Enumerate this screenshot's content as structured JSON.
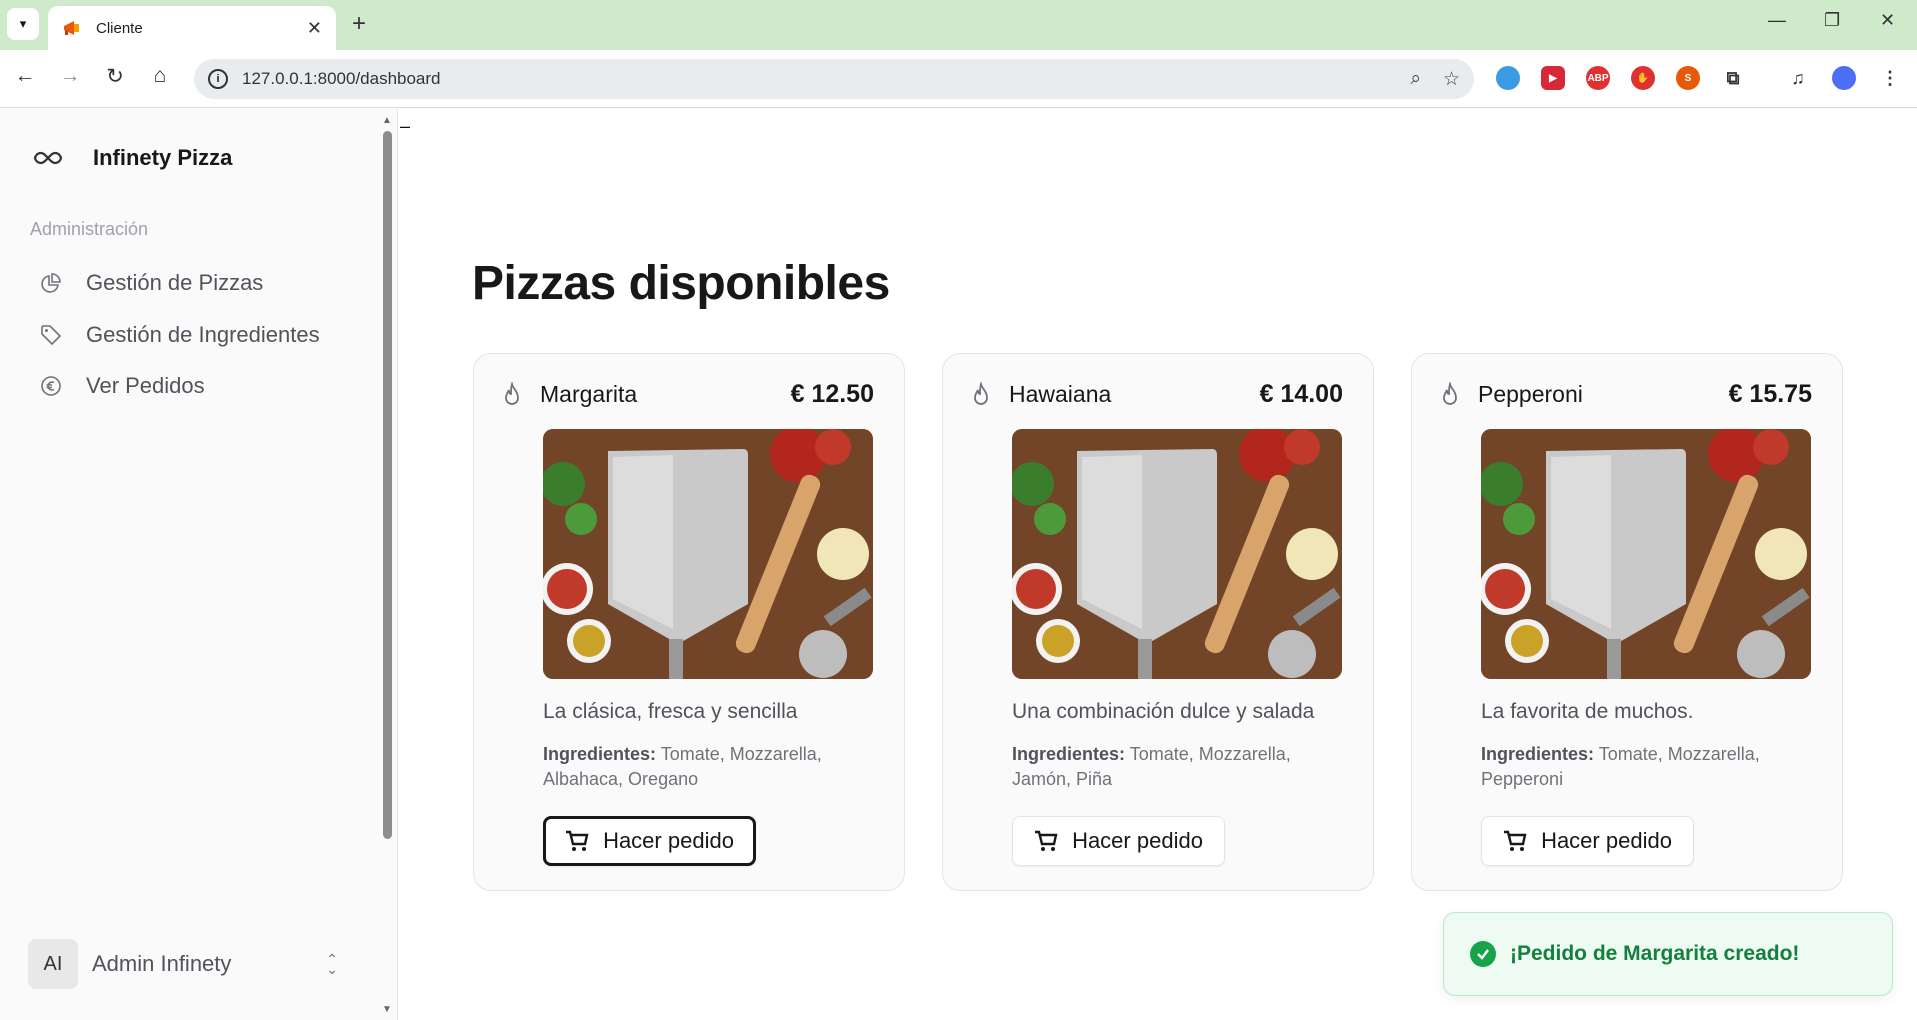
{
  "browser": {
    "tab_title": "Cliente",
    "url": "127.0.0.1:8000/dashboard",
    "accent": "#cfeacb"
  },
  "sidebar": {
    "brand": "Infinety Pizza",
    "section_label": "Administración",
    "items": [
      {
        "label": "Gestión de Pizzas",
        "icon": "pie-chart-icon"
      },
      {
        "label": "Gestión de Ingredientes",
        "icon": "tag-icon"
      },
      {
        "label": "Ver Pedidos",
        "icon": "euro-icon"
      }
    ],
    "user": {
      "initials": "AI",
      "name": "Admin Infinety"
    }
  },
  "main": {
    "cursor_mark": "–",
    "title": "Pizzas disponibles",
    "ingredients_label": "Ingredientes:",
    "order_label": "Hacer pedido",
    "pizzas": [
      {
        "name": "Margarita",
        "price": "€ 12.50",
        "description": "La clásica, fresca y sencilla",
        "ingredients": "Tomate, Mozzarella, Albahaca, Oregano"
      },
      {
        "name": "Hawaiana",
        "price": "€ 14.00",
        "description": "Una combinación dulce y salada",
        "ingredients": "Tomate, Mozzarella, Jamón, Piña"
      },
      {
        "name": "Pepperoni",
        "price": "€ 15.75",
        "description": "La favorita de muchos.",
        "ingredients": "Tomate, Mozzarella, Pepperoni"
      }
    ]
  },
  "toast": {
    "message": "¡Pedido de Margarita creado!",
    "color": "#16a34a"
  }
}
